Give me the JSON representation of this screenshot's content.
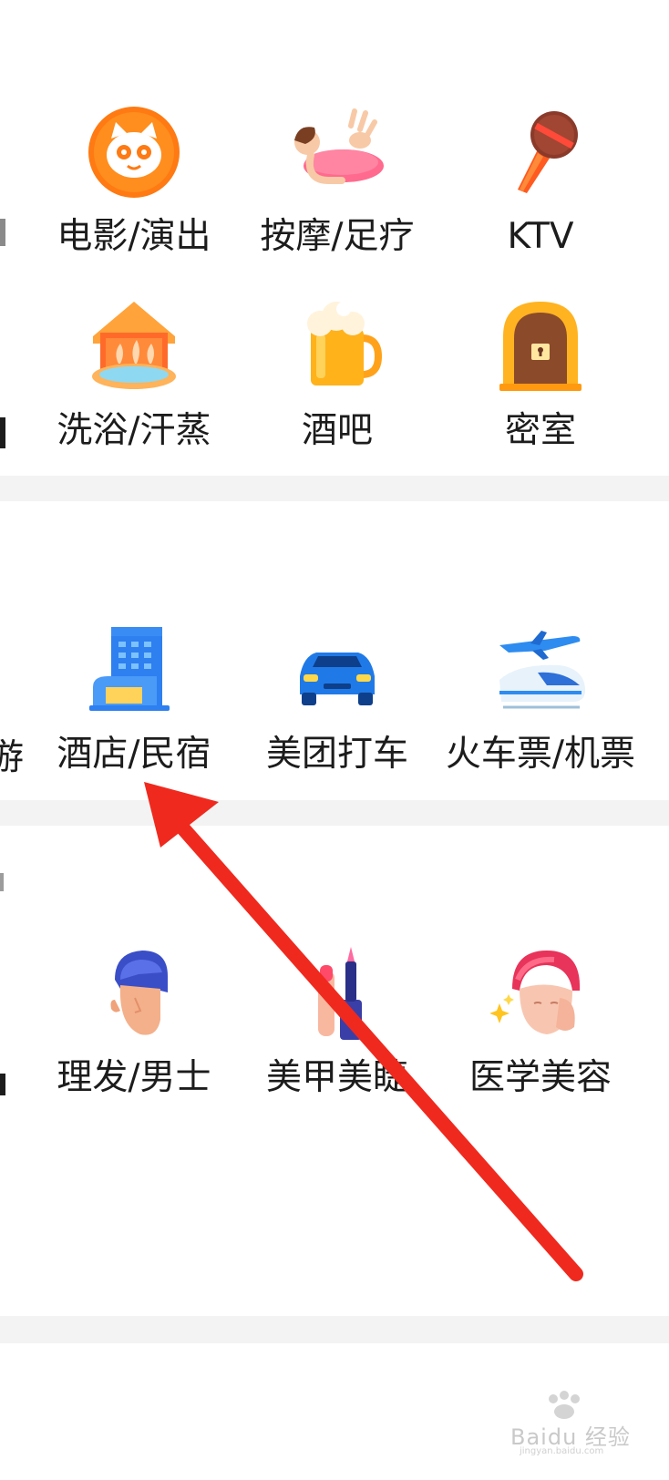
{
  "section1": {
    "row1": [
      {
        "label": "电影/演出",
        "icon": "cat-film-icon"
      },
      {
        "label": "按摩/足疗",
        "icon": "massage-icon"
      },
      {
        "label": "KTV",
        "icon": "microphone-icon"
      }
    ],
    "row2": [
      {
        "label": "洗浴/汗蒸",
        "icon": "bath-house-icon"
      },
      {
        "label": "酒吧",
        "icon": "beer-mug-icon"
      },
      {
        "label": "密室",
        "icon": "locked-door-icon"
      }
    ]
  },
  "section2": {
    "items": [
      {
        "label": "酒店/民宿",
        "icon": "hotel-building-icon"
      },
      {
        "label": "美团打车",
        "icon": "car-icon"
      },
      {
        "label": "火车票/机票",
        "icon": "train-plane-icon"
      }
    ],
    "clipped_left": "游"
  },
  "section3": {
    "items": [
      {
        "label": "理发/男士",
        "icon": "hair-man-icon"
      },
      {
        "label": "美甲美睫",
        "icon": "nail-polish-icon"
      },
      {
        "label": "医学美容",
        "icon": "face-care-icon"
      }
    ]
  },
  "watermark": {
    "text": "Baidu 经验",
    "url": "jingyan.baidu.com"
  },
  "colors": {
    "accent_arrow": "#f0291e",
    "divider": "#f3f3f3",
    "text": "#1c1c1c"
  }
}
